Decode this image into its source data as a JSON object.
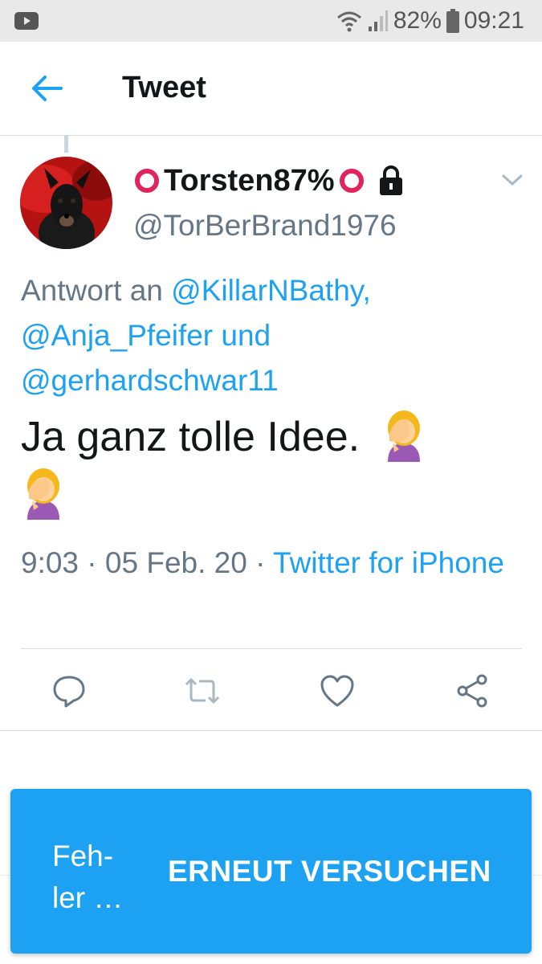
{
  "status_bar": {
    "battery_percent": "82%",
    "time": "09:21",
    "icons": [
      "youtube-icon",
      "wifi-icon",
      "signal-icon",
      "battery-icon"
    ]
  },
  "header": {
    "title": "Tweet",
    "back_icon": "arrow-left-icon"
  },
  "tweet": {
    "display_name": "Torsten87%",
    "handle": "@TorBerBrand1976",
    "reply_prefix": "Antwort an ",
    "mentions": [
      "@KillarNBathy,",
      "@Anja_Pfeifer und",
      "@gerhardschwar11"
    ],
    "text": "Ja ganz tolle Idee.",
    "emoji": "face-palm-emoji",
    "time": "9:03",
    "separator": " · ",
    "date": "05 Feb. 20",
    "source": "Twitter for iPhone"
  },
  "actions": [
    "reply-icon",
    "retweet-icon",
    "like-icon",
    "share-icon"
  ],
  "snackbar": {
    "message": "Feh- ler …",
    "action": "ERNEUT VERSUCHEN"
  },
  "colors": {
    "accent": "#1da1f2",
    "secondary_text": "#657786",
    "ring_red": "#e0245e"
  }
}
